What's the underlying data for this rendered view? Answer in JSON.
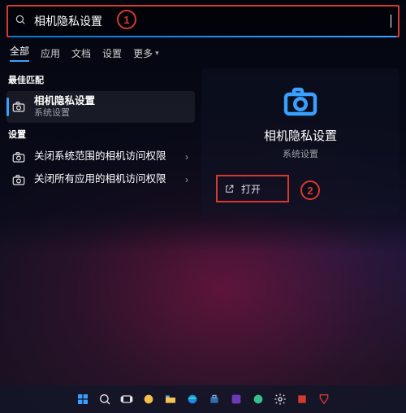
{
  "search": {
    "value": "相机隐私设置"
  },
  "callouts": {
    "one": "1",
    "two": "2"
  },
  "tabs": {
    "all": "全部",
    "apps": "应用",
    "docs": "文档",
    "settings": "设置",
    "more": "更多"
  },
  "sections": {
    "best_match": "最佳匹配",
    "settings": "设置"
  },
  "results": {
    "best": {
      "title": "相机隐私设置",
      "sub": "系统设置"
    },
    "items": [
      {
        "title": "关闭系统范围的相机访问权限"
      },
      {
        "title": "关闭所有应用的相机访问权限"
      }
    ]
  },
  "preview": {
    "title": "相机隐私设置",
    "sub": "系统设置",
    "open": "打开"
  }
}
